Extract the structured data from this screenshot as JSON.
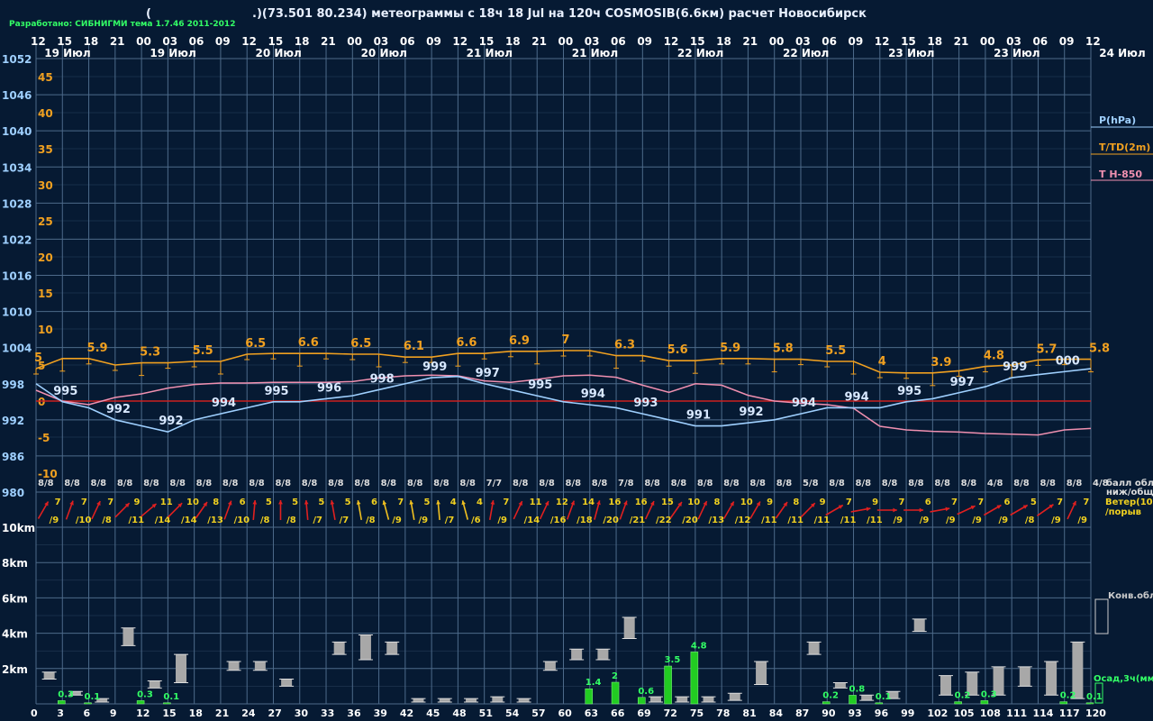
{
  "header": {
    "credits": "Разработано: СИБНИГМИ тема 1.7.46 2011-2012",
    "open_paren": "(",
    "title": ".)(73.501 80.234) метеограммы с  18ч 18 Jul на 120ч COSMOSIB(6.6км) расчет Новосибирск"
  },
  "chart_data": {
    "type": "line",
    "hours_top": [
      "12",
      "15",
      "18",
      "21",
      "00",
      "03",
      "06",
      "09",
      "12",
      "15",
      "18",
      "21",
      "00",
      "03",
      "06",
      "09",
      "12",
      "15",
      "18",
      "21",
      "00",
      "03",
      "06",
      "09",
      "12",
      "15",
      "18",
      "21",
      "00",
      "03",
      "06",
      "09",
      "12",
      "15",
      "18",
      "21",
      "00",
      "03",
      "06",
      "09",
      "12"
    ],
    "date_labels": [
      {
        "text": "19 Июл",
        "i": 1
      },
      {
        "text": "19 Июл",
        "i": 5
      },
      {
        "text": "20 Июл",
        "i": 9
      },
      {
        "text": "20 Июл",
        "i": 13
      },
      {
        "text": "21 Июл",
        "i": 17
      },
      {
        "text": "21 Июл",
        "i": 21
      },
      {
        "text": "22 Июл",
        "i": 25
      },
      {
        "text": "22 Июл",
        "i": 29
      },
      {
        "text": "23 Июл",
        "i": 33
      },
      {
        "text": "23 Июл",
        "i": 37
      },
      {
        "text": "24 Июл",
        "i": 41
      }
    ],
    "pressure_ticks": [
      "1052",
      "1046",
      "1040",
      "1034",
      "1028",
      "1022",
      "1016",
      "1010",
      "1004",
      "998",
      "992",
      "986",
      "980"
    ],
    "temp_ticks": [
      "45",
      "40",
      "35",
      "30",
      "25",
      "20",
      "15",
      "10",
      "5",
      "0",
      "-5",
      "-10"
    ],
    "height_ticks": [
      "10km",
      "8km",
      "6km",
      "4km",
      "2km"
    ],
    "legend": {
      "pressure": "P(hPa)",
      "temp": "T/TD(2m)",
      "t850": "T H-850",
      "clouds_label": "балл обл.\nниж/общ",
      "wind_label": "Ветер(10м)\n/порыв",
      "conv": "Конв.обл.",
      "precip": "Осад,3ч(мм)"
    },
    "colors": {
      "bg": "#061a33",
      "grid": "#4d6a8a",
      "pressure": "#9fd0ff",
      "temp": "#f0a020",
      "t850": "#f090b0",
      "wind": "#e02020",
      "wind_yellow": "#f0c020",
      "precip": "#22cc22",
      "cloud": "#a8a8a8",
      "zeroline": "#cc2020"
    },
    "pressure_values": [
      998,
      995,
      994,
      992,
      991,
      990,
      992,
      993,
      994,
      995,
      995,
      995.5,
      996,
      997,
      998,
      999,
      999.2,
      998,
      997,
      996,
      995,
      994.5,
      994,
      993,
      992,
      991,
      991,
      991.5,
      992,
      993,
      994,
      994,
      994,
      995,
      995.5,
      996.5,
      997.5,
      999,
      999.5,
      1000,
      1000.5
    ],
    "pressure_labels": [
      {
        "t": "995",
        "i": 1
      },
      {
        "t": "992",
        "i": 3
      },
      {
        "t": "992",
        "i": 5
      },
      {
        "t": "994",
        "i": 7
      },
      {
        "t": "995",
        "i": 9
      },
      {
        "t": "996",
        "i": 11
      },
      {
        "t": "998",
        "i": 13
      },
      {
        "t": "999",
        "i": 15
      },
      {
        "t": "997",
        "i": 17
      },
      {
        "t": "995",
        "i": 19
      },
      {
        "t": "994",
        "i": 21
      },
      {
        "t": "993",
        "i": 23
      },
      {
        "t": "991",
        "i": 25
      },
      {
        "t": "992",
        "i": 27
      },
      {
        "t": "994",
        "i": 29
      },
      {
        "t": "994",
        "i": 31
      },
      {
        "t": "995",
        "i": 33
      },
      {
        "t": "997",
        "i": 35
      },
      {
        "t": "999",
        "i": 37
      },
      {
        "t": "000",
        "i": 39
      }
    ],
    "temp_values": [
      4.5,
      5.9,
      5.9,
      5,
      5.3,
      5.3,
      5.5,
      5.5,
      6.5,
      6.6,
      6.6,
      6.6,
      6.5,
      6.5,
      6.1,
      6.1,
      6.6,
      6.6,
      6.9,
      6.9,
      7,
      7,
      6.3,
      6.3,
      5.6,
      5.6,
      5.9,
      5.9,
      5.8,
      5.8,
      5.5,
      5.5,
      4,
      3.9,
      3.9,
      4.2,
      4.8,
      5,
      5.7,
      5.8,
      5.8
    ],
    "temp_labels": [
      {
        "t": "5",
        "i": 0
      },
      {
        "t": "5.9",
        "i": 2
      },
      {
        "t": "5.3",
        "i": 4
      },
      {
        "t": "5.5",
        "i": 6
      },
      {
        "t": "6.5",
        "i": 8
      },
      {
        "t": "6.6",
        "i": 10
      },
      {
        "t": "6.5",
        "i": 12
      },
      {
        "t": "6.1",
        "i": 14
      },
      {
        "t": "6.6",
        "i": 16
      },
      {
        "t": "6.9",
        "i": 18
      },
      {
        "t": "7",
        "i": 20
      },
      {
        "t": "6.3",
        "i": 22
      },
      {
        "t": "5.6",
        "i": 24
      },
      {
        "t": "5.9",
        "i": 26
      },
      {
        "t": "5.8",
        "i": 28
      },
      {
        "t": "5.5",
        "i": 30
      },
      {
        "t": "4",
        "i": 32
      },
      {
        "t": "3.9",
        "i": 34
      },
      {
        "t": "4.8",
        "i": 36
      },
      {
        "t": "5.7",
        "i": 38
      },
      {
        "t": "5.8",
        "i": 40
      }
    ],
    "t850_values": [
      1.5,
      0,
      -0.5,
      0.5,
      1,
      1.8,
      2.3,
      2.5,
      2.5,
      2.6,
      2.6,
      2.6,
      2.7,
      3.2,
      3.5,
      3.6,
      3.5,
      2.8,
      2.6,
      3,
      3.5,
      3.6,
      3.3,
      2.2,
      1.2,
      2.4,
      2.2,
      0.8,
      0,
      -0.3,
      -0.5,
      -1,
      -3.5,
      -4,
      -4.2,
      -4.3,
      -4.5,
      -4.6,
      -4.7,
      -4.0,
      -3.8
    ],
    "cloud_labels": [
      "8/8",
      "8/8",
      "8/8",
      "8/8",
      "8/8",
      "8/8",
      "8/8",
      "8/8",
      "8/8",
      "8/8",
      "8/8",
      "8/8",
      "8/8",
      "8/8",
      "8/8",
      "8/8",
      "8/8",
      "7/7",
      "8/8",
      "8/8",
      "8/8",
      "8/8",
      "7/8",
      "8/8",
      "8/8",
      "8/8",
      "8/8",
      "8/8",
      "8/8",
      "5/8",
      "8/8",
      "8/8",
      "8/8",
      "8/8",
      "8/8",
      "8/8",
      "4/8",
      "8/8",
      "8/8",
      "8/8",
      "4/8"
    ],
    "wind_speed": [
      "7",
      "7",
      "7",
      "9",
      "11",
      "10",
      "8",
      "6",
      "5",
      "5",
      "5",
      "5",
      "6",
      "7",
      "5",
      "4",
      "4",
      "7",
      "11",
      "12",
      "14",
      "16",
      "16",
      "15",
      "10",
      "8",
      "10",
      "9",
      "8",
      "9",
      "7",
      "9",
      "7",
      "6",
      "7",
      "7",
      "6",
      "5",
      "7",
      "7"
    ],
    "wind_gust": [
      "/9",
      "/10",
      "/8",
      "/11",
      "/14",
      "/14",
      "/13",
      "/10",
      "/8",
      "/8",
      "/7",
      "/7",
      "/8",
      "/9",
      "/9",
      "/7",
      "/6",
      "/9",
      "/14",
      "/16",
      "/18",
      "/20",
      "/21",
      "/22",
      "/20",
      "/13",
      "/12",
      "/11",
      "/11",
      "/11",
      "/11",
      "/11",
      "/9",
      "/9",
      "/9",
      "/9",
      "/9",
      "/8",
      "/9",
      "/9"
    ],
    "wind_dir_deg": [
      210,
      200,
      205,
      225,
      230,
      225,
      215,
      200,
      185,
      180,
      175,
      170,
      170,
      165,
      170,
      175,
      165,
      190,
      205,
      205,
      200,
      195,
      200,
      205,
      215,
      205,
      210,
      210,
      215,
      225,
      240,
      260,
      270,
      270,
      260,
      245,
      240,
      240,
      235,
      205
    ],
    "wind_yellow": [
      12,
      13,
      14,
      15,
      16
    ],
    "hours_bottom": [
      "0",
      "3",
      "6",
      "9",
      "12",
      "15",
      "18",
      "21",
      "24",
      "27",
      "30",
      "33",
      "36",
      "39",
      "42",
      "45",
      "48",
      "51",
      "54",
      "57",
      "60",
      "63",
      "66",
      "69",
      "72",
      "75",
      "78",
      "81",
      "84",
      "87",
      "90",
      "93",
      "96",
      "99",
      "102",
      "105",
      "108",
      "111",
      "114",
      "117",
      "120"
    ],
    "precip": [
      {
        "i": 1,
        "v": 0.3,
        "t": "0.3"
      },
      {
        "i": 2,
        "v": 0.1,
        "t": "0.1"
      },
      {
        "i": 4,
        "v": 0.3,
        "t": "0.3"
      },
      {
        "i": 5,
        "v": 0.1,
        "t": "0.1"
      },
      {
        "i": 21,
        "v": 1.4,
        "t": "1.4"
      },
      {
        "i": 22,
        "v": 2.0,
        "t": "2"
      },
      {
        "i": 23,
        "v": 0.6,
        "t": "0.6"
      },
      {
        "i": 24,
        "v": 3.5,
        "t": "3.5"
      },
      {
        "i": 25,
        "v": 4.8,
        "t": "4.8"
      },
      {
        "i": 30,
        "v": 0.2,
        "t": "0.2"
      },
      {
        "i": 31,
        "v": 0.8,
        "t": "0.8"
      },
      {
        "i": 32,
        "v": 0.1,
        "t": "0.1"
      },
      {
        "i": 35,
        "v": 0.2,
        "t": "0.2"
      },
      {
        "i": 36,
        "v": 0.3,
        "t": "0.3"
      },
      {
        "i": 39,
        "v": 0.2,
        "t": "0.2"
      },
      {
        "i": 40,
        "v": 0.1,
        "t": "0.1"
      }
    ],
    "clouds_km": [
      [
        1.4,
        1.8
      ],
      [
        0.5,
        0.7
      ],
      [
        0.1,
        0.3
      ],
      [
        3.3,
        4.3
      ],
      [
        0.9,
        1.3
      ],
      [
        1.2,
        2.8
      ],
      null,
      [
        1.9,
        2.4
      ],
      [
        1.9,
        2.4
      ],
      [
        1.0,
        1.4
      ],
      null,
      [
        2.8,
        3.5
      ],
      [
        2.5,
        3.9
      ],
      [
        2.8,
        3.5
      ],
      [
        0.1,
        0.3
      ],
      [
        0.1,
        0.3
      ],
      [
        0.1,
        0.3
      ],
      [
        0.1,
        0.4
      ],
      [
        0.1,
        0.3
      ],
      [
        1.9,
        2.4
      ],
      [
        2.5,
        3.1
      ],
      [
        2.5,
        3.1
      ],
      [
        3.7,
        4.9
      ],
      [
        0.1,
        0.4
      ],
      [
        0.1,
        0.4
      ],
      [
        0.1,
        0.4
      ],
      [
        0.2,
        0.6
      ],
      [
        1.1,
        2.4
      ],
      null,
      [
        2.8,
        3.5
      ],
      [
        0.9,
        1.2
      ],
      [
        0.2,
        0.5
      ],
      [
        0.3,
        0.7
      ],
      [
        4.1,
        4.8
      ],
      [
        0.5,
        1.6
      ],
      [
        0.5,
        1.8
      ],
      [
        0.5,
        2.1
      ],
      [
        1.0,
        2.1
      ],
      [
        0.5,
        2.4
      ],
      [
        0.3,
        3.5
      ]
    ]
  }
}
